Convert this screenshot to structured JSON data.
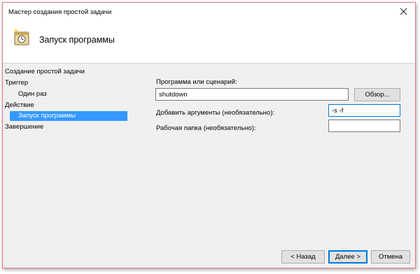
{
  "window": {
    "title": "Мастер создания простой задачи"
  },
  "header": {
    "title": "Запуск программы",
    "icon": "task-clock-icon"
  },
  "sidebar": {
    "items": [
      {
        "label": "Создание простой задачи"
      },
      {
        "label": "Триггер"
      },
      {
        "label": "Один раз"
      },
      {
        "label": "Действие"
      },
      {
        "label": "Запуск программы",
        "selected": true
      },
      {
        "label": "Завершение"
      }
    ]
  },
  "form": {
    "program_label": "Программа или сценарий:",
    "program_value": "shutdown",
    "browse_label": "Обзор...",
    "args_label": "Добавить аргументы (необязательно):",
    "args_value": "-s -f",
    "workdir_label": "Рабочая папка (необязательно):",
    "workdir_value": ""
  },
  "footer": {
    "back_label": "< Назад",
    "next_label": "Далее >",
    "cancel_label": "Отмена"
  },
  "colors": {
    "selection": "#3399ff",
    "focus_border": "#0078d7",
    "window_border": "#e57886"
  }
}
